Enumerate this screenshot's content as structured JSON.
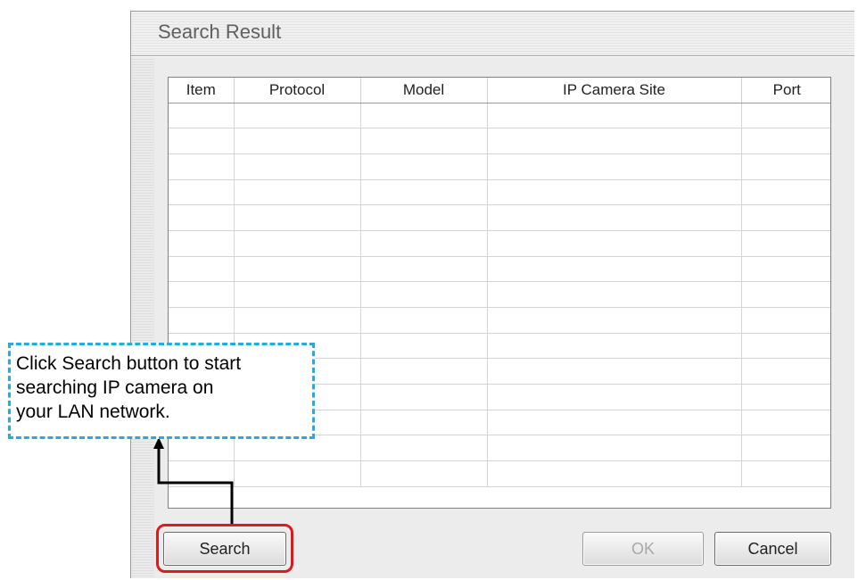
{
  "dialog": {
    "title": "Search Result"
  },
  "table": {
    "columns": [
      "Item",
      "Protocol",
      "Model",
      "IP Camera Site",
      "Port"
    ],
    "empty_rows": 15
  },
  "buttons": {
    "search": "Search",
    "ok": "OK",
    "cancel": "Cancel"
  },
  "callout": {
    "lines": [
      "Click Search button to start",
      "searching IP camera on",
      "your LAN network."
    ]
  },
  "colors": {
    "callout_border": "#2aa8e0",
    "highlight": "#e0191e",
    "connector": "#000000"
  }
}
